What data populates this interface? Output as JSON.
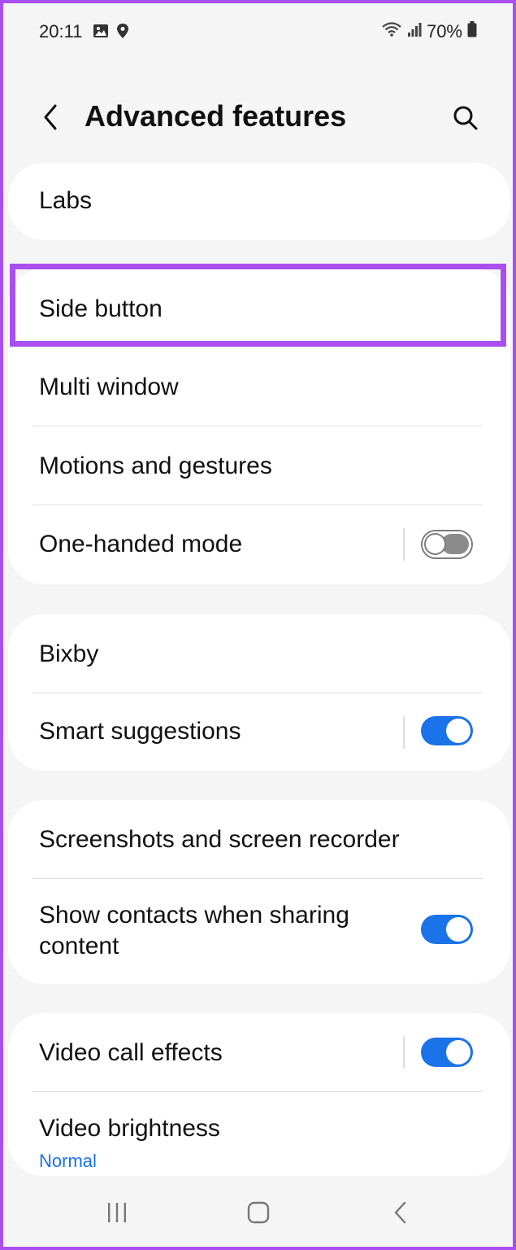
{
  "status_bar": {
    "time": "20:11",
    "battery": "70%",
    "icons": [
      "gallery-icon",
      "location-pin-icon",
      "wifi-icon",
      "signal-icon",
      "battery-icon"
    ]
  },
  "header": {
    "title": "Advanced features",
    "back_icon": "chevron-left-icon",
    "search_icon": "search-icon"
  },
  "sections": {
    "labs": {
      "label": "Labs"
    },
    "side_button": {
      "label": "Side button"
    },
    "multi_window": {
      "label": "Multi window"
    },
    "motions": {
      "label": "Motions and gestures"
    },
    "one_handed": {
      "label": "One-handed mode",
      "enabled": false
    },
    "bixby": {
      "label": "Bixby"
    },
    "smart_suggestions": {
      "label": "Smart suggestions",
      "enabled": true
    },
    "screenshots": {
      "label": "Screenshots and screen recorder"
    },
    "show_contacts": {
      "label_line1": "Show contacts when sharing",
      "label_line2": "content",
      "enabled": true
    },
    "video_call": {
      "label": "Video call effects",
      "enabled": true
    },
    "video_brightness": {
      "label": "Video brightness",
      "value": "Normal"
    }
  },
  "colors": {
    "accent": "#1a73e8",
    "highlight": "#a94ff0",
    "background": "#f5f5f5"
  },
  "nav": {
    "icons": [
      "recent-apps-icon",
      "home-icon",
      "back-icon"
    ]
  }
}
